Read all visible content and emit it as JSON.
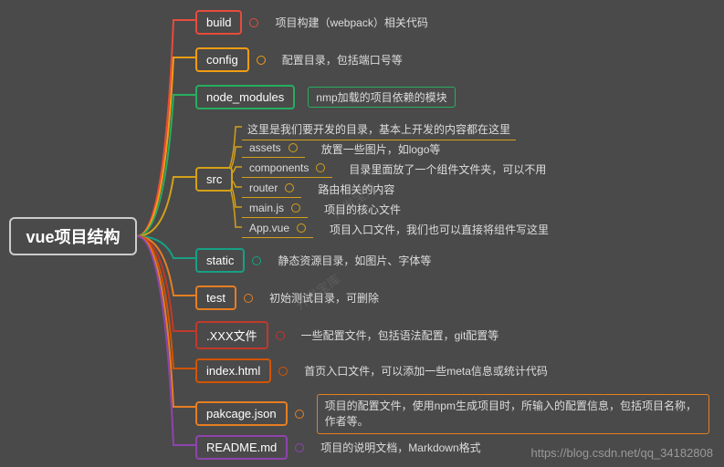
{
  "root": "vue项目结构",
  "branches": {
    "build": {
      "label": "build",
      "desc": "项目构建（webpack）相关代码",
      "color": "#e74c3c"
    },
    "config": {
      "label": "config",
      "desc": "配置目录，包括端口号等",
      "color": "#f39c12"
    },
    "node_modules": {
      "label": "node_modules",
      "sub_label": "nmp加载的项目依赖的模块",
      "color": "#27ae60"
    },
    "src": {
      "label": "src",
      "color": "#d4a017",
      "header_desc": "这里是我们要开发的目录，基本上开发的内容都在这里",
      "children": [
        {
          "label": "assets",
          "desc": "放置一些图片，如logo等"
        },
        {
          "label": "components",
          "desc": "目录里面放了一个组件文件夹，可以不用"
        },
        {
          "label": "router",
          "desc": "路由相关的内容"
        },
        {
          "label": "main.js",
          "desc": "项目的核心文件"
        },
        {
          "label": "App.vue",
          "desc": "项目入口文件，我们也可以直接将组件写这里"
        }
      ]
    },
    "static": {
      "label": "static",
      "desc": "静态资源目录，如图片、字体等",
      "color": "#16a085"
    },
    "test": {
      "label": "test",
      "desc": "初始测试目录，可删除",
      "color": "#e67e22"
    },
    "xxx": {
      "label": ".XXX文件",
      "desc": "一些配置文件，包括语法配置，git配置等",
      "color": "#c0392b"
    },
    "index": {
      "label": "index.html",
      "desc": "首页入口文件，可以添加一些meta信息或统计代码",
      "color": "#d35400"
    },
    "package": {
      "label": "pakcage.json",
      "desc": "项目的配置文件，使用npm生成项目时，所输入的配置信息，包括项目名称，作者等。",
      "color": "#e67e22"
    },
    "readme": {
      "label": "README.md",
      "desc": "项目的说明文档，Markdown格式",
      "color": "#8e44ad"
    }
  },
  "watermark": "开发宝库",
  "url": "https://blog.csdn.net/qq_34182808"
}
